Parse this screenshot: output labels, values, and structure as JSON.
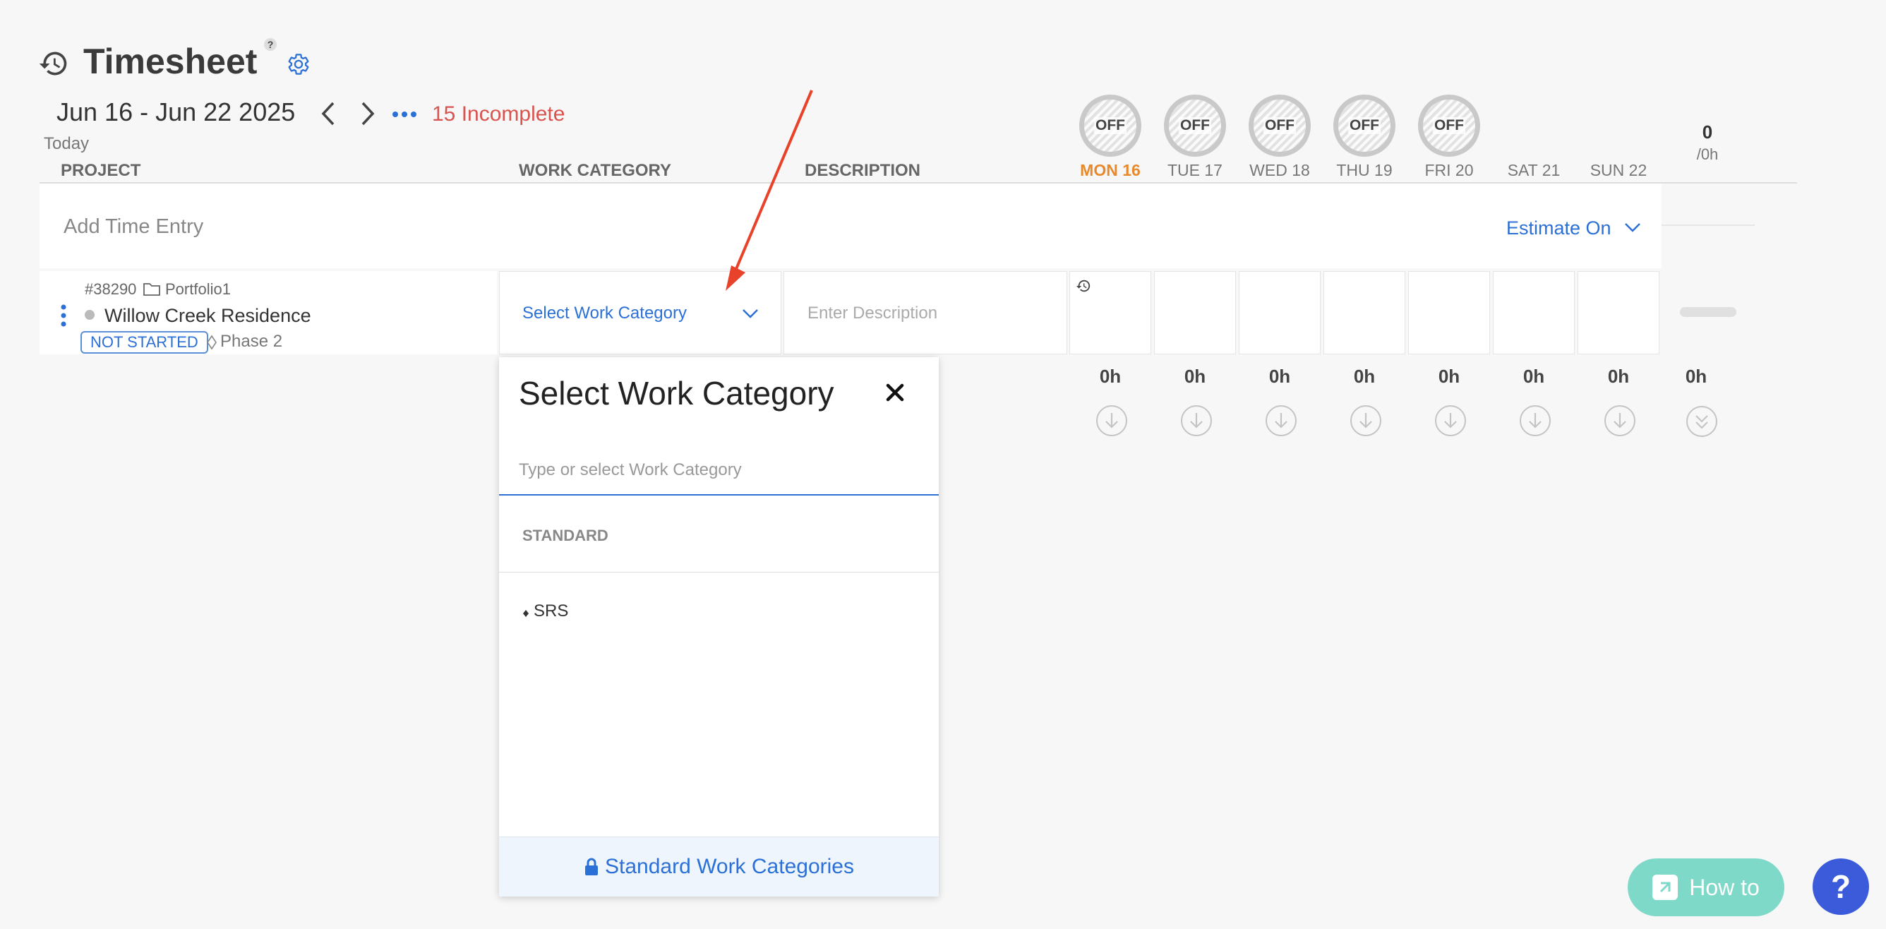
{
  "header": {
    "title": "Timesheet",
    "title_help": "?",
    "date_range": "Jun 16 - Jun 22 2025",
    "today_label": "Today",
    "incomplete": "15 Incomplete"
  },
  "columns": {
    "project": "PROJECT",
    "work_category": "WORK CATEGORY",
    "description": "DESCRIPTION"
  },
  "days": [
    {
      "label": "MON 16",
      "off": "OFF",
      "hours": "0h",
      "today": true
    },
    {
      "label": "TUE 17",
      "off": "OFF",
      "hours": "0h"
    },
    {
      "label": "WED 18",
      "off": "OFF",
      "hours": "0h"
    },
    {
      "label": "THU 19",
      "off": "OFF",
      "hours": "0h"
    },
    {
      "label": "FRI 20",
      "off": "OFF",
      "hours": "0h"
    },
    {
      "label": "SAT 21",
      "hours": "0h"
    },
    {
      "label": "SUN 22",
      "hours": "0h"
    }
  ],
  "total": {
    "value": "0",
    "sub": "/0h",
    "hours": "0h"
  },
  "add_entry": {
    "label": "Add Time Entry",
    "estimate": "Estimate On"
  },
  "row": {
    "project_number": "#38290",
    "portfolio": "Portfolio1",
    "project_name": "Willow Creek Residence",
    "status": "NOT STARTED",
    "phase": "Phase 2",
    "work_category": "Select Work Category",
    "description_placeholder": "Enter Description"
  },
  "dropdown": {
    "title": "Select Work Category",
    "search_placeholder": "Type or select Work Category",
    "section": "STANDARD",
    "items": [
      "SRS"
    ],
    "footer": "Standard Work Categories"
  },
  "help": {
    "how_to": "How to",
    "help": "?"
  },
  "colors": {
    "accent": "#2b70d6",
    "incomplete": "#d9534f",
    "today": "#e88a2c",
    "arrow": "#e8432a"
  }
}
